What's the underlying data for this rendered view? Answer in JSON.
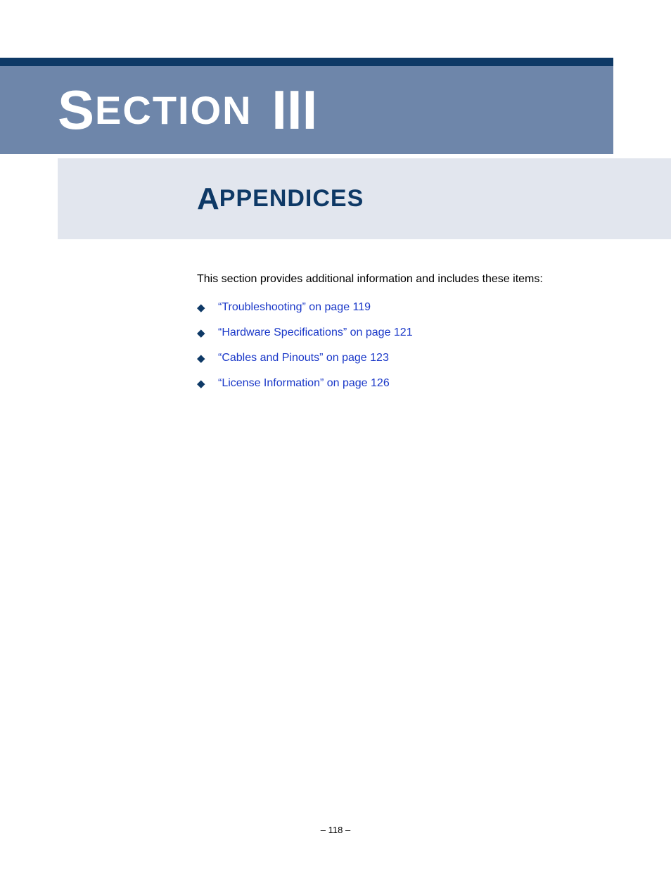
{
  "header": {
    "section_cap": "S",
    "section_rest": "ECTION",
    "section_number": "III"
  },
  "title": {
    "cap": "A",
    "rest": "PPENDICES"
  },
  "intro": "This section provides additional information and includes these items:",
  "links": [
    {
      "text": "“Troubleshooting” on page 119"
    },
    {
      "text": "“Hardware Specifications” on page 121"
    },
    {
      "text": "“Cables and Pinouts” on page 123"
    },
    {
      "text": "“License Information” on page 126"
    }
  ],
  "footer": {
    "page": "–  118  –"
  }
}
